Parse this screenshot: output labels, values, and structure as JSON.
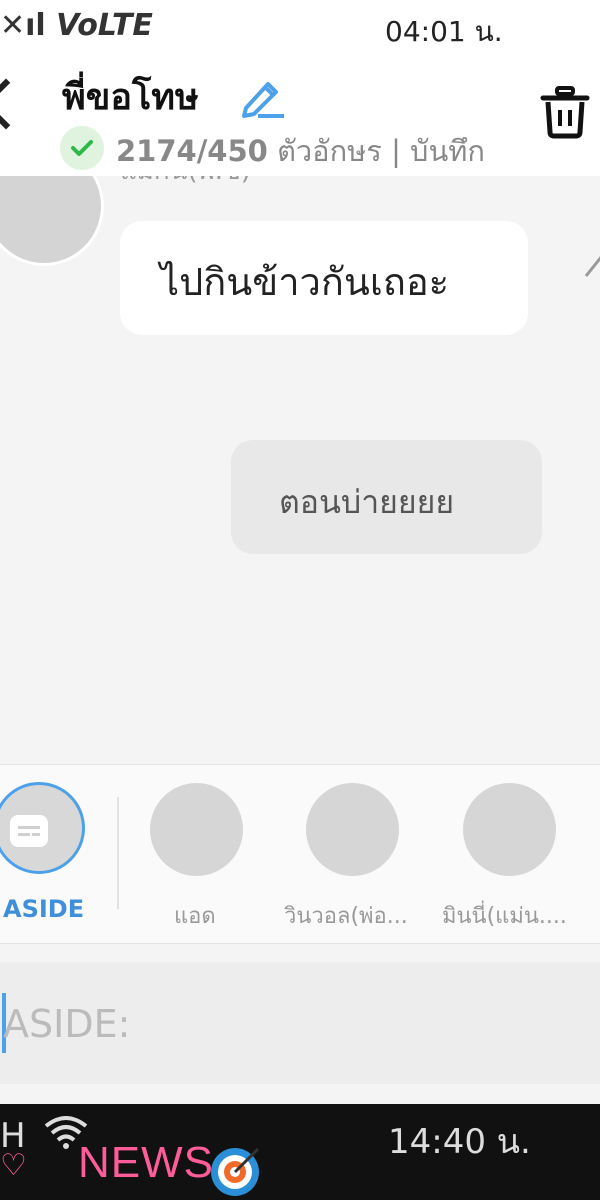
{
  "status_bar": {
    "signal": "✕ıl",
    "network": "VoLTE",
    "time": "04:01 น."
  },
  "header": {
    "title": "พี่ขอโทษ",
    "char_count": "2174/450",
    "char_unit": "ตัวอักษร | บันทึก"
  },
  "chat": {
    "partial_name": "แมกน(พ.ข)",
    "messages": [
      {
        "text": "ไปกินข้าวกันเถอะ"
      },
      {
        "text": "ตอนบ่ายยยย"
      }
    ]
  },
  "characters": {
    "aside_label": "ASIDE",
    "items": [
      {
        "label": "แอด"
      },
      {
        "label": "วินวอล(พ่อ..."
      },
      {
        "label": "มินนี่(แม่น...."
      }
    ]
  },
  "input": {
    "placeholder": "ASIDE:"
  },
  "overlay": {
    "left_text": "H",
    "heart": "♡",
    "news": "NEWS",
    "time": "14:40 น."
  },
  "colors": {
    "accent": "#4da1ea",
    "check": "#2fb84a",
    "news": "#ff5c9a"
  }
}
